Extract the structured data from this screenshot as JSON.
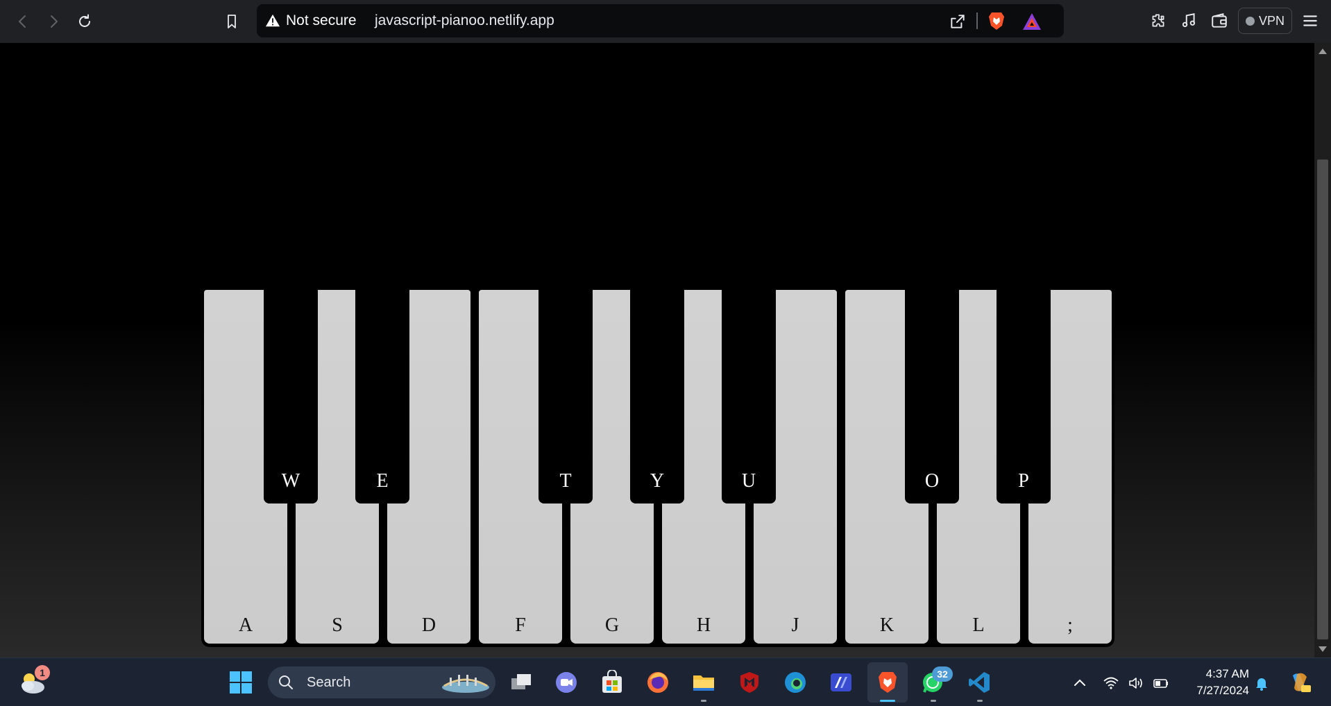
{
  "browser": {
    "security_status": "Not secure",
    "url": "javascript-pianoo.netlify.app",
    "vpn_label": "VPN",
    "icons": [
      "back-icon",
      "forward-icon",
      "reload-icon",
      "bookmark-icon",
      "warning-icon",
      "share-icon",
      "brave-shields-icon",
      "brave-rewards-icon",
      "extensions-icon",
      "media-icon",
      "wallet-icon",
      "vpn-icon",
      "menu-icon"
    ]
  },
  "piano": {
    "white_keys": [
      "A",
      "S",
      "D",
      "F",
      "G",
      "H",
      "J",
      "K",
      "L",
      ";"
    ],
    "black_keys": [
      "W",
      "E",
      "T",
      "Y",
      "U",
      "O",
      "P"
    ],
    "colors": {
      "white_key": "#d0d0d0",
      "black_key": "#000000",
      "background": "#000000"
    }
  },
  "taskbar": {
    "search_placeholder": "Search",
    "weather_badge": "1",
    "whatsapp_badge": "32",
    "time": "4:37 AM",
    "date": "7/27/2024",
    "accent": "#4cc2ff"
  }
}
